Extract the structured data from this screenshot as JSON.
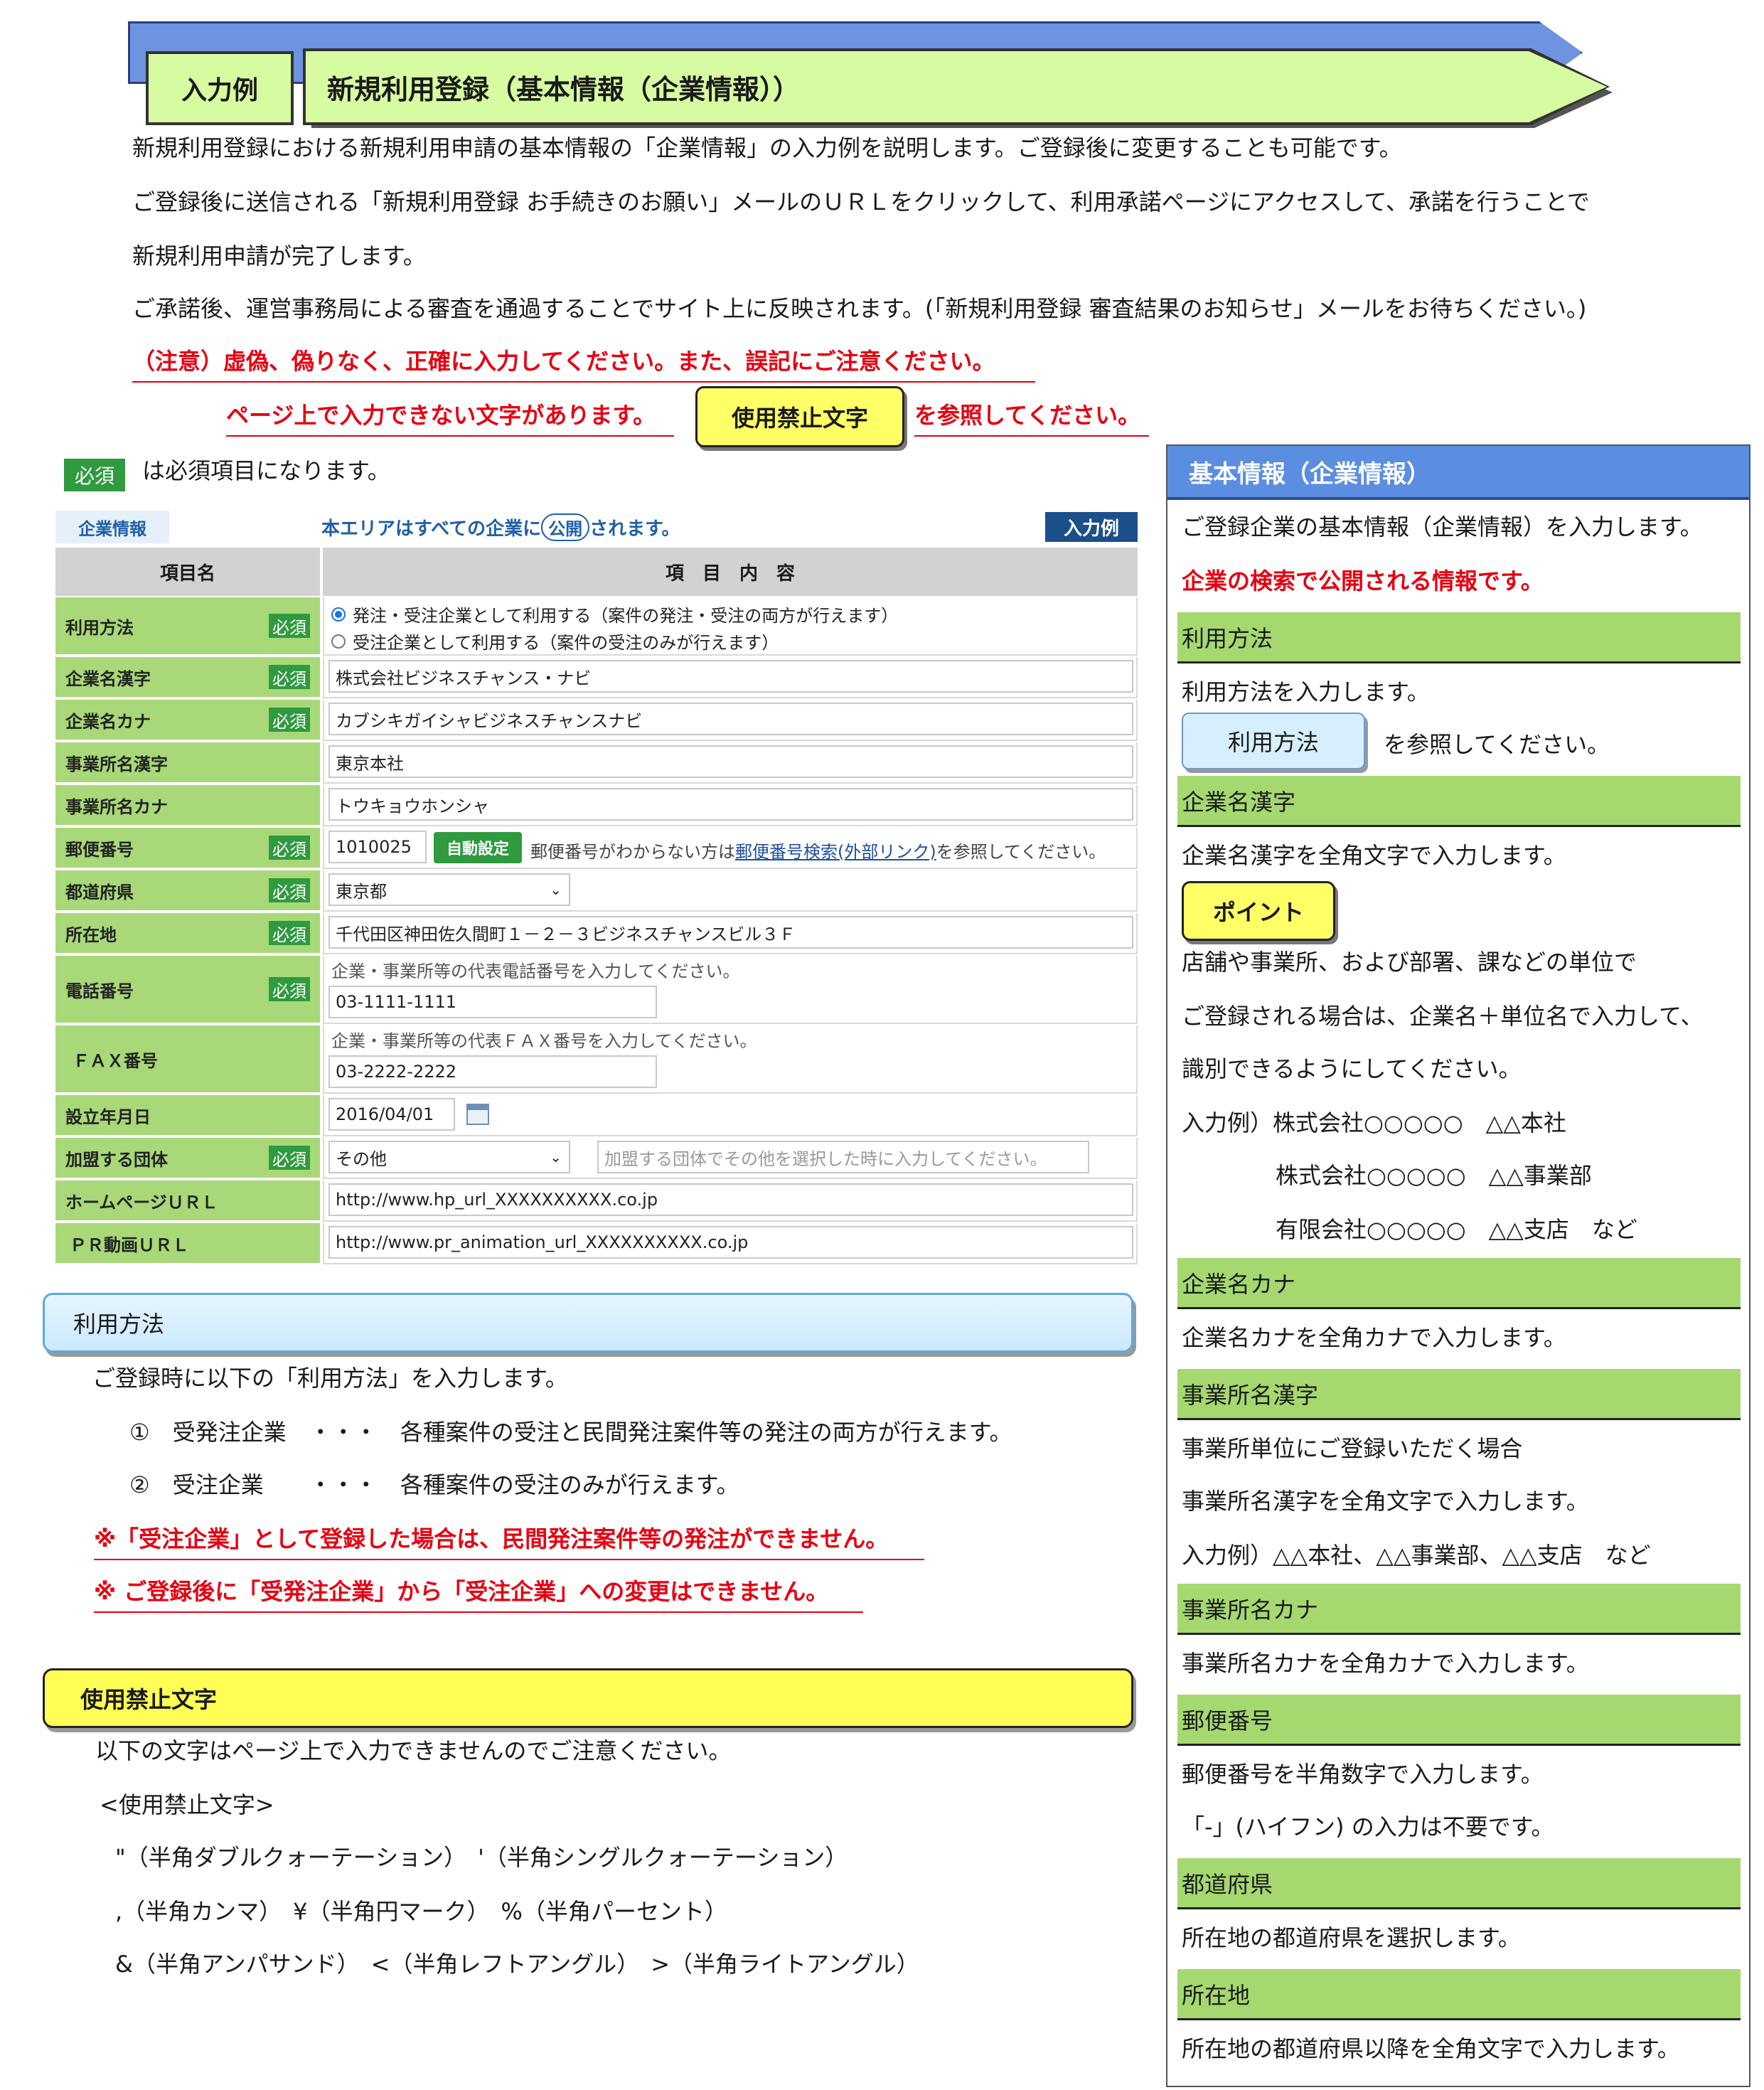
{
  "header": {
    "tag": "入力例",
    "title": "新規利用登録（基本情報（企業情報））"
  },
  "intro": {
    "line1": "新規利用登録における新規利用申請の基本情報の「企業情報」の入力例を説明します。ご登録後に変更することも可能です。",
    "line2": "ご登録後に送信される「新規利用登録 お手続きのお願い」メールのＵＲＬをクリックして、利用承諾ページにアクセスして、承諾を行うことで",
    "line3": "新規利用申請が完了します。",
    "line4": "ご承諾後、運営事務局による審査を通過することでサイト上に反映されます。(「新規利用登録 審査結果のお知らせ」メールをお待ちください。)",
    "warn1": "（注意）虚偽、偽りなく、正確に入力してください。また、誤記にご注意ください。",
    "warn2_pre": "ページ上で入力できない文字があります。",
    "warn2_button": "使用禁止文字",
    "warn2_post": "を参照してください。",
    "required_badge": "必須",
    "required_note": "は必須項目になります。"
  },
  "form": {
    "tab": "企業情報",
    "public_note_pre": "本エリアはすべての企業に",
    "public_badge": "公開",
    "public_note_post": "されます。",
    "example_button": "入力例",
    "col_name": "項目名",
    "col_content": "項　目　内　容",
    "required": "必須",
    "usage_label": "利用方法",
    "usage_opt1": "発注・受注企業として利用する（案件の発注・受注の両方が行えます）",
    "usage_opt2": "受注企業として利用する（案件の受注のみが行えます）",
    "name_kanji_label": "企業名漢字",
    "name_kanji_value": "株式会社ビジネスチャンス・ナビ",
    "name_kana_label": "企業名カナ",
    "name_kana_value": "カブシキガイシャビジネスチャンスナビ",
    "office_kanji_label": "事業所名漢字",
    "office_kanji_value": "東京本社",
    "office_kana_label": "事業所名カナ",
    "office_kana_value": "トウキョウホンシャ",
    "postal_label": "郵便番号",
    "postal_value": "1010025",
    "postal_button": "自動設定",
    "postal_note_pre": "郵便番号がわからない方は",
    "postal_link": "郵便番号検索(外部リンク)",
    "postal_note_post": "を参照してください。",
    "pref_label": "都道府県",
    "pref_value": "東京都",
    "address_label": "所在地",
    "address_value": "千代田区神田佐久間町１－２－３ビジネスチャンスビル３Ｆ",
    "tel_label": "電話番号",
    "tel_hint": "企業・事業所等の代表電話番号を入力してください。",
    "tel_value": "03-1111-1111",
    "fax_label": "ＦＡＸ番号",
    "fax_hint": "企業・事業所等の代表ＦＡＸ番号を入力してください。",
    "fax_value": "03-2222-2222",
    "founded_label": "設立年月日",
    "founded_value": "2016/04/01",
    "group_label": "加盟する団体",
    "group_value": "その他",
    "group_placeholder": "加盟する団体でその他を選択した時に入力してください。",
    "hp_label": "ホームページＵＲＬ",
    "hp_value": "http://www.hp_url_XXXXXXXXXX.co.jp",
    "pr_label": "ＰＲ動画ＵＲＬ",
    "pr_value": "http://www.pr_animation_url_XXXXXXXXXX.co.jp"
  },
  "usage_box": {
    "title": "利用方法",
    "intro": "ご登録時に以下の「利用方法」を入力します。",
    "item1": "①　受発注企業　・・・　各種案件の受注と民間発注案件等の発注の両方が行えます。",
    "item2": "②　受注企業　　・・・　各種案件の受注のみが行えます。",
    "warn1": "※「受注企業」として登録した場合は、民間発注案件等の発注ができません。",
    "warn2": "※ ご登録後に「受発注企業」から「受注企業」への変更はできません。"
  },
  "banned_box": {
    "title": "使用禁止文字",
    "intro": "以下の文字はページ上で入力できませんのでご注意ください。",
    "heading": "<使用禁止文字>",
    "line1": "\"（半角ダブルクォーテーション）　'（半角シングルクォーテーション）",
    "line2": ",（半角カンマ）　¥（半角円マーク）　%（半角パーセント）",
    "line3": "&（半角アンパサンド）　<（半角レフトアングル）　>（半角ライトアングル）"
  },
  "right_panel": {
    "title": "基本情報（企業情報）",
    "intro": "ご登録企業の基本情報（企業情報）を入力します。",
    "intro_red": "企業の検索で公開される情報です。",
    "s1_title": "利用方法",
    "s1_t1": "利用方法を入力します。",
    "s1_button": "利用方法",
    "s1_t2": "を参照してください。",
    "s2_title": "企業名漢字",
    "s2_t1": "企業名漢字を全角文字で入力します。",
    "s2_point": "ポイント",
    "s2_t2": "店舗や事業所、および部署、課などの単位で",
    "s2_t3": "ご登録される場合は、企業名＋単位名で入力して、",
    "s2_t4": "識別できるようにしてください。",
    "s2_ex1": "入力例）株式会社○○○○○　△△本社",
    "s2_ex2": "株式会社○○○○○　△△事業部",
    "s2_ex3": "有限会社○○○○○　△△支店　など",
    "s3_title": "企業名カナ",
    "s3_t1": "企業名カナを全角カナで入力します。",
    "s4_title": "事業所名漢字",
    "s4_t1": "事業所単位にご登録いただく場合",
    "s4_t2": "事業所名漢字を全角文字で入力します。",
    "s4_t3": "入力例）△△本社、△△事業部、△△支店　など",
    "s5_title": "事業所名カナ",
    "s5_t1": "事業所名カナを全角カナで入力します。",
    "s6_title": "郵便番号",
    "s6_t1": "郵便番号を半角数字で入力します。",
    "s6_t2": "「-」(ハイフン) の入力は不要です。",
    "s7_title": "都道府県",
    "s7_t1": "所在地の都道府県を選択します。",
    "s8_title": "所在地",
    "s8_t1": "所在地の都道府県以降を全角文字で入力します。"
  }
}
